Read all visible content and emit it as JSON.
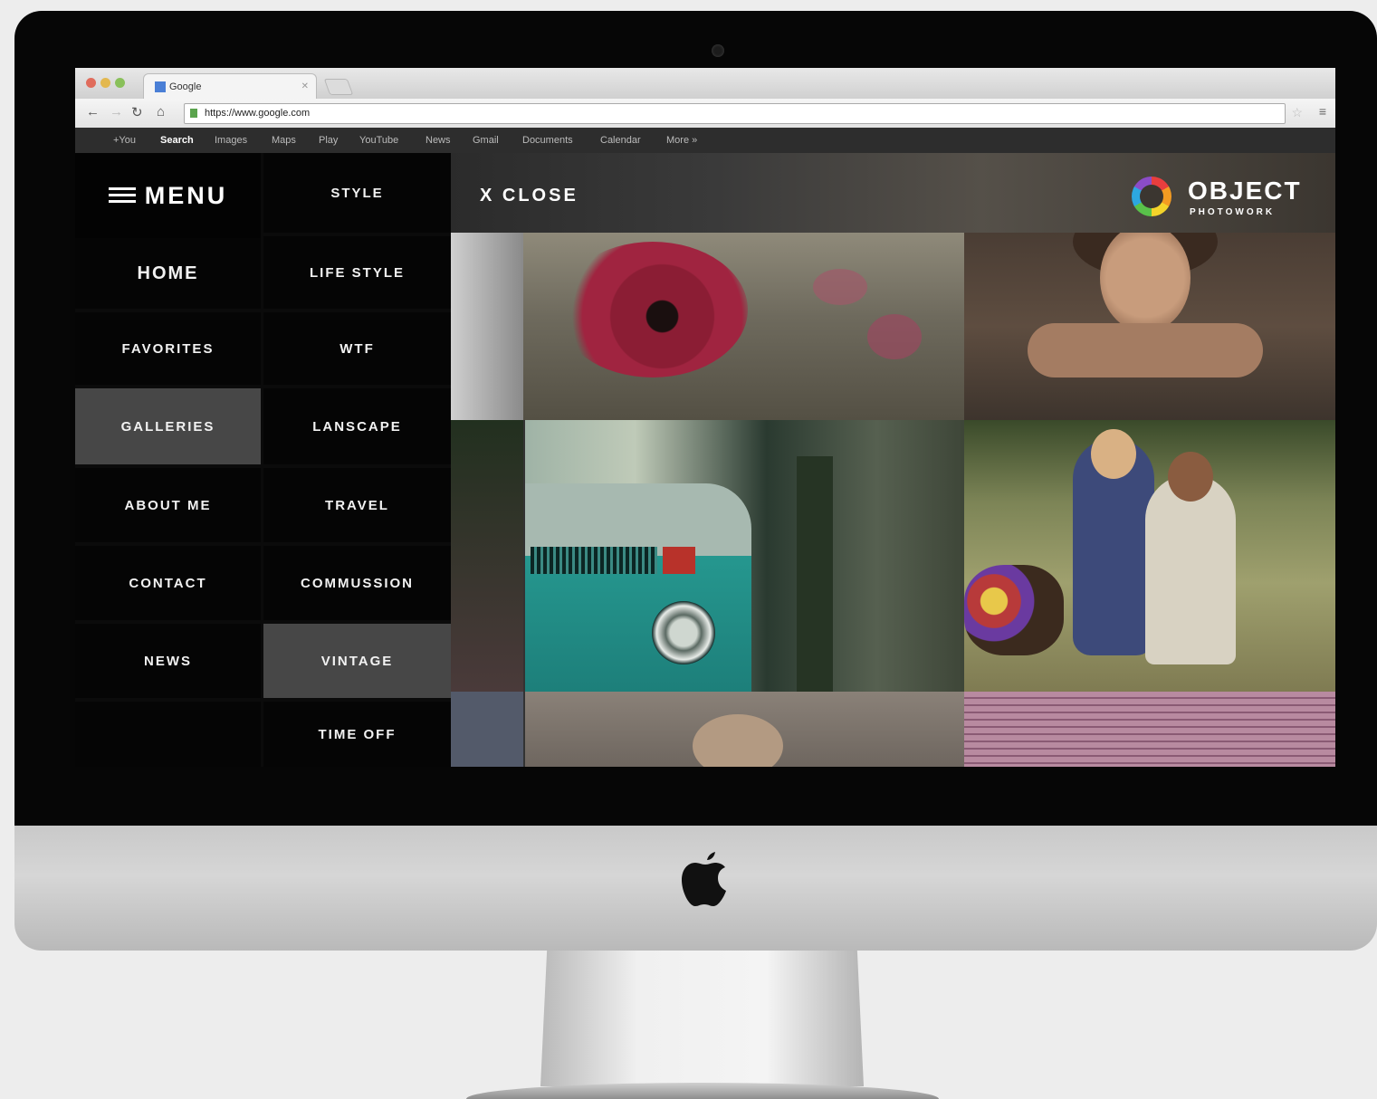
{
  "browser": {
    "tab_title": "Google",
    "url": "https://www.google.com",
    "google_bar": [
      "+You",
      "Search",
      "Images",
      "Maps",
      "Play",
      "YouTube",
      "News",
      "Gmail",
      "Documents",
      "Calendar",
      "More »"
    ]
  },
  "site": {
    "menu_title": "MENU",
    "close_label": "X  CLOSE",
    "logo": {
      "name": "OBJECT",
      "subtitle": "PHOTOWORK"
    },
    "main_menu": [
      {
        "label": "HOME",
        "active": false
      },
      {
        "label": "FAVORITES",
        "active": false
      },
      {
        "label": "GALLERIES",
        "active": true
      },
      {
        "label": "ABOUT ME",
        "active": false
      },
      {
        "label": "CONTACT",
        "active": false
      },
      {
        "label": "NEWS",
        "active": false
      }
    ],
    "sub_menu": [
      {
        "label": "STYLE",
        "active": false
      },
      {
        "label": "LIFE STYLE",
        "active": false
      },
      {
        "label": "WTF",
        "active": false
      },
      {
        "label": "LANSCAPE",
        "active": false
      },
      {
        "label": "TRAVEL",
        "active": false
      },
      {
        "label": "COMMUSSION",
        "active": false
      },
      {
        "label": "VINTAGE",
        "active": true
      },
      {
        "label": "TIME OFF",
        "active": false
      }
    ]
  },
  "colors": {
    "bezel": "#060606",
    "menu_bg": "#050505",
    "menu_active": "#474747",
    "menu_text": "#f2f2f2"
  },
  "icons": {
    "menu": "hamburger-icon",
    "close": "x-icon",
    "brand": "apple-logo-icon",
    "logo": "color-ring-icon"
  }
}
